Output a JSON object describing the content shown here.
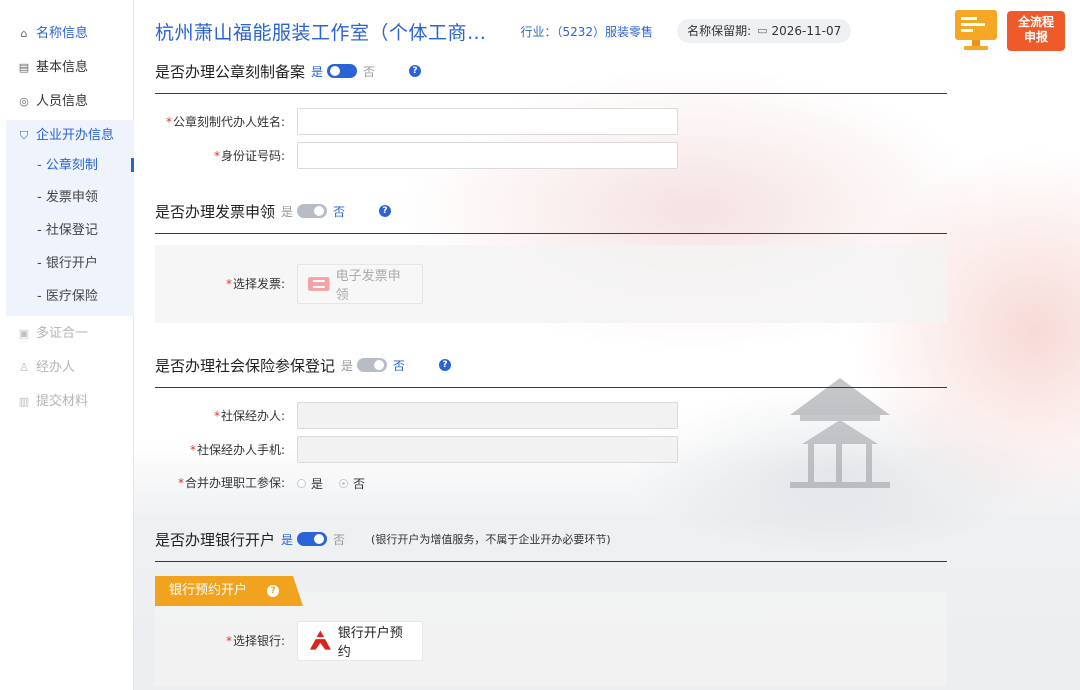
{
  "sidebar": {
    "items": [
      {
        "label": "名称信息",
        "icon": "home-icon"
      },
      {
        "label": "基本信息",
        "icon": "document-icon"
      },
      {
        "label": "人员信息",
        "icon": "person-circle-icon"
      },
      {
        "label": "企业开办信息",
        "icon": "shield-icon"
      },
      {
        "label": "多证合一",
        "icon": "certificate-icon"
      },
      {
        "label": "经办人",
        "icon": "agent-icon"
      },
      {
        "label": "提交材料",
        "icon": "file-icon"
      }
    ],
    "sub_items": [
      "- 公章刻制",
      "- 发票申领",
      "- 社保登记",
      "- 银行开户",
      "- 医疗保险"
    ]
  },
  "header": {
    "company": "杭州萧山福能服装工作室（个体工商…",
    "industry": "行业：（5232）服装零售",
    "reserve_label": "名称保留期:",
    "reserve_date": "2026-11-07",
    "badge_line1": "全流程",
    "badge_line2": "申报"
  },
  "sections": {
    "seal": {
      "title": "是否办理公章刻制备案",
      "yes": "是",
      "no": "否",
      "agent_name_label": "公章刻制代办人姓名:",
      "id_label": "身份证号码:"
    },
    "invoice": {
      "title": "是否办理发票申领",
      "yes": "是",
      "no": "否",
      "select_label": "选择发票:",
      "button": "电子发票申领"
    },
    "social": {
      "title": "是否办理社会保险参保登记",
      "yes": "是",
      "no": "否",
      "agent_label": "社保经办人:",
      "phone_label": "社保经办人手机:",
      "merge_label": "合并办理职工参保:",
      "opt_yes": "是",
      "opt_no": "否"
    },
    "bank": {
      "title": "是否办理银行开户",
      "yes": "是",
      "no": "否",
      "note": "(银行开户为增值服务，不属于企业开办必要环节)",
      "tab": "银行预约开户",
      "select_label": "选择银行:",
      "button": "银行开户预约"
    }
  },
  "colors": {
    "accent": "#2a63d6",
    "required": "#e0362c",
    "tab": "#f1a320",
    "badge": "#ee5a2a"
  }
}
